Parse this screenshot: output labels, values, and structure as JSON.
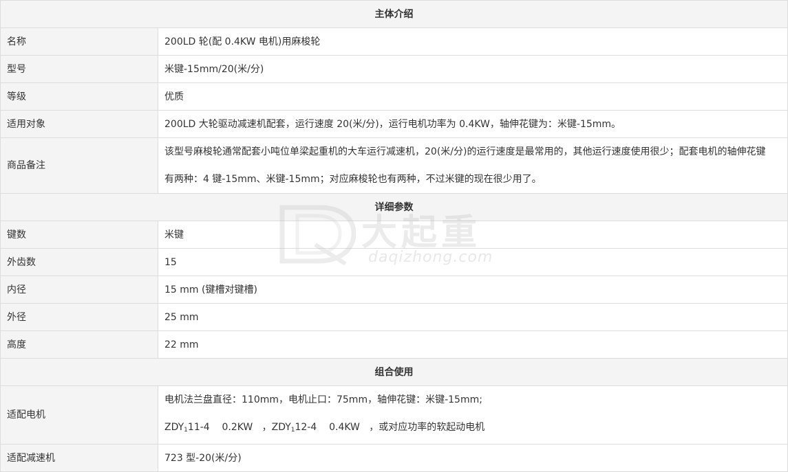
{
  "sections": [
    {
      "title": "主体介绍"
    },
    {
      "title": "详细参数"
    },
    {
      "title": "组合使用"
    }
  ],
  "intro": [
    {
      "label": "名称",
      "value": "200LD 轮(配 0.4KW 电机)用麻梭轮"
    },
    {
      "label": "型号",
      "value": "米键-15mm/20(米/分)"
    },
    {
      "label": "等级",
      "value": "优质"
    },
    {
      "label": "适用对象",
      "value": "200LD 大轮驱动减速机配套，运行速度 20(米/分)，运行电机功率为 0.4KW，轴伸花键为：米键-15mm。"
    },
    {
      "label": "商品备注",
      "lines": [
        "该型号麻梭轮通常配套小吨位单梁起重机的大车运行减速机，20(米/分)的运行速度是最常用的，其他运行速度使用很少；配套电机的轴伸花键",
        "有两种：4 键-15mm、米键-15mm；对应麻梭轮也有两种，不过米键的现在很少用了。"
      ]
    }
  ],
  "params": [
    {
      "label": "键数",
      "value": "米键"
    },
    {
      "label": "外齿数",
      "value": "15"
    },
    {
      "label": "内径",
      "value": "15 mm (键槽对键槽)"
    },
    {
      "label": "外径",
      "value": "25 mm"
    },
    {
      "label": "高度",
      "value": "22 mm"
    }
  ],
  "combo": {
    "motor_label": "适配电机",
    "motor_line1": "电机法兰盘直径：110mm，电机止口：75mm，轴伸花键：米键-15mm;",
    "motor_line2": {
      "prefix": "ZDY",
      "sub": "1",
      "part1": "11-4    0.2KW   ，ZDY",
      "sub2": "1",
      "part2": "12-4    0.4KW   ，或对应功率的软起动电机"
    },
    "reducer_label": "适配减速机",
    "reducer_value": "723 型-20(米/分)"
  },
  "watermark": {
    "brand": "大起重",
    "site": "daqizhong.com"
  }
}
